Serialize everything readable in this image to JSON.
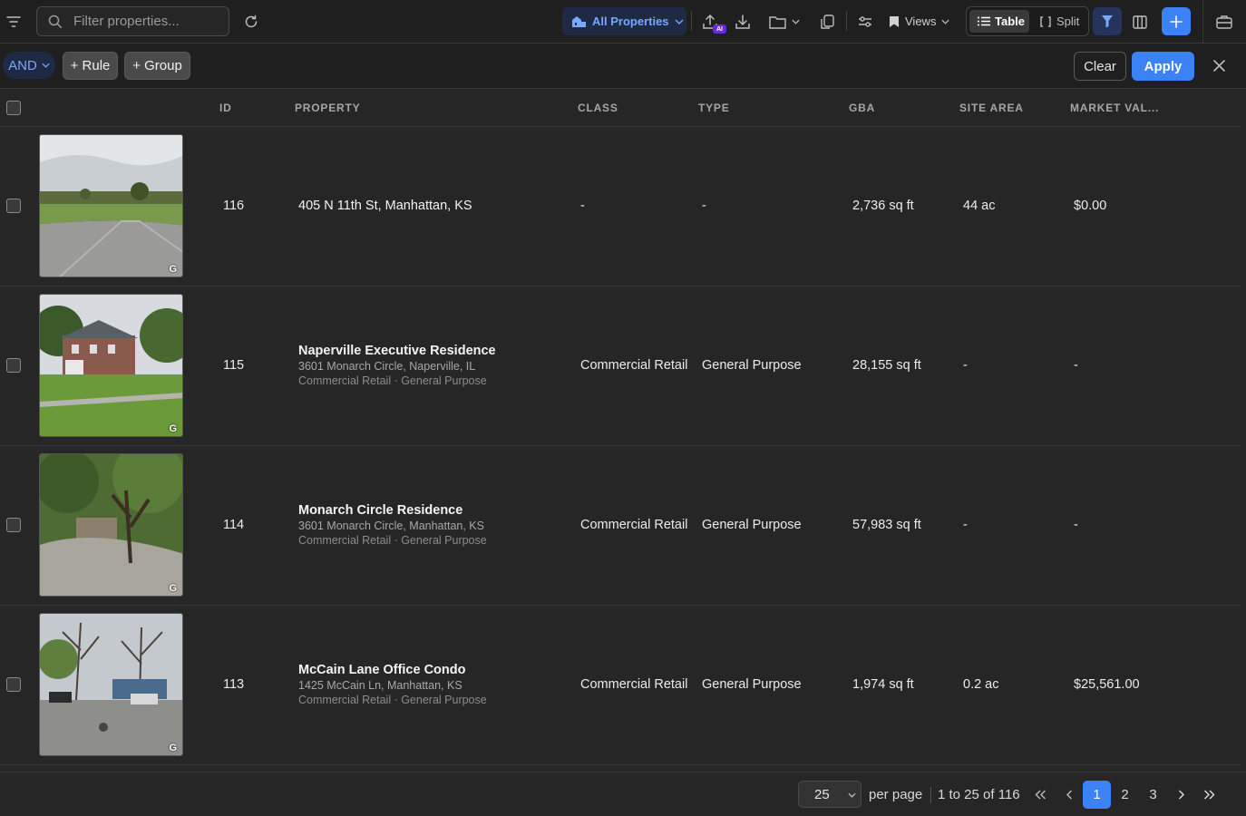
{
  "toolbar": {
    "search_placeholder": "Filter properties...",
    "all_properties_label": "All Properties",
    "ai_badge": "AI",
    "views_label": "Views",
    "table_label": "Table",
    "split_label": "Split"
  },
  "filterbar": {
    "logic": "AND",
    "add_rule_label": "+ Rule",
    "add_group_label": "+ Group",
    "clear_label": "Clear",
    "apply_label": "Apply"
  },
  "columns": {
    "id": "ID",
    "property": "PROPERTY",
    "class": "CLASS",
    "type": "TYPE",
    "gba": "GBA",
    "site_area": "SITE AREA",
    "market_value": "MARKET VAL..."
  },
  "rows": [
    {
      "id": "116",
      "name": "405 N 11th St, Manhattan, KS",
      "address": "",
      "subtitle": "",
      "class": "-",
      "type": "-",
      "gba": "2,736 sq ft",
      "site_area": "44 ac",
      "market_value": "$0.00",
      "google_mark": "G"
    },
    {
      "id": "115",
      "name": "Naperville Executive Residence",
      "address": "3601 Monarch Circle, Naperville, IL",
      "subtitle": "Commercial Retail · General Purpose",
      "class": "Commercial Retail",
      "type": "General Purpose",
      "gba": "28,155 sq ft",
      "site_area": "-",
      "market_value": "-",
      "google_mark": "G"
    },
    {
      "id": "114",
      "name": "Monarch Circle Residence",
      "address": "3601 Monarch Circle, Manhattan, KS",
      "subtitle": "Commercial Retail · General Purpose",
      "class": "Commercial Retail",
      "type": "General Purpose",
      "gba": "57,983 sq ft",
      "site_area": "-",
      "market_value": "-",
      "google_mark": "G"
    },
    {
      "id": "113",
      "name": "McCain Lane Office Condo",
      "address": "1425 McCain Ln, Manhattan, KS",
      "subtitle": "Commercial Retail · General Purpose",
      "class": "Commercial Retail",
      "type": "General Purpose",
      "gba": "1,974 sq ft",
      "site_area": "0.2 ac",
      "market_value": "$25,561.00",
      "google_mark": "G"
    }
  ],
  "pagination": {
    "per_page_value": "25",
    "per_page_label": "per page",
    "range_text": "1 to 25 of 116",
    "pages": [
      "1",
      "2",
      "3"
    ],
    "current_page": "1"
  },
  "colors": {
    "accent": "#3b82f6",
    "accent_text": "#7aa7ff",
    "background": "#262626",
    "toolbar": "#1f1f1f"
  }
}
